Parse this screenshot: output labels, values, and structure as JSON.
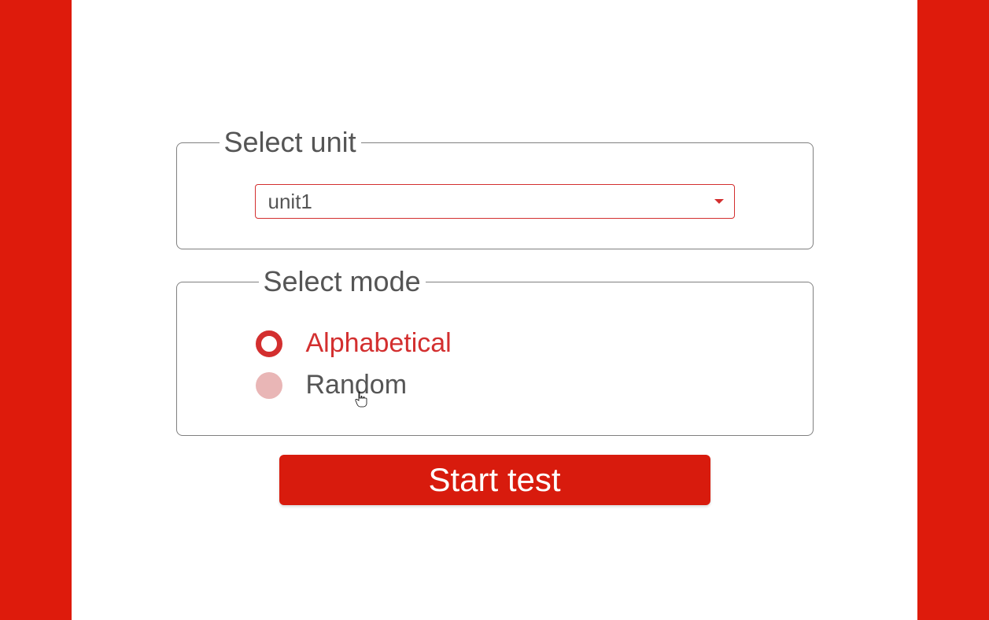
{
  "unit_section": {
    "legend": "Select unit",
    "selected_value": "unit1"
  },
  "mode_section": {
    "legend": "Select mode",
    "options": [
      {
        "label": "Alphabetical",
        "selected": true
      },
      {
        "label": "Random",
        "selected": false
      }
    ]
  },
  "start_button": {
    "label": "Start test"
  }
}
